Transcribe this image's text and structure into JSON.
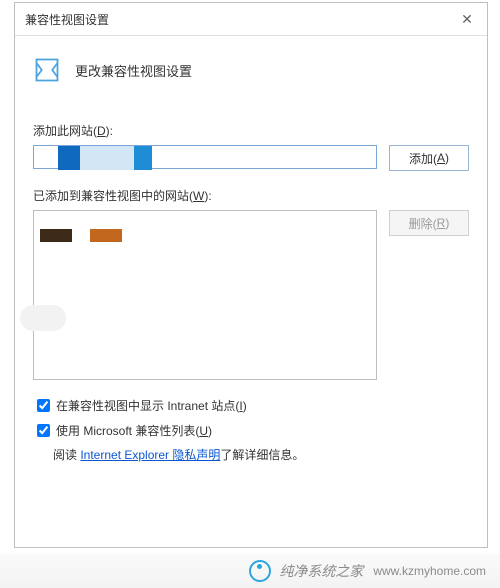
{
  "titlebar": {
    "title": "兼容性视图设置"
  },
  "header": {
    "text": "更改兼容性视图设置"
  },
  "add": {
    "label": "添加此网站(",
    "label_key": "D",
    "label_tail": "):",
    "btn": "添加(",
    "btn_key": "A",
    "btn_tail": ")"
  },
  "list": {
    "label": "已添加到兼容性视图中的网站(",
    "label_key": "W",
    "label_tail": "):",
    "remove_btn": "删除(",
    "remove_key": "R",
    "remove_tail": ")"
  },
  "checkbox1": {
    "label": "在兼容性视图中显示 Intranet 站点(",
    "key": "I",
    "tail": ")"
  },
  "checkbox2": {
    "label": "使用 Microsoft 兼容性列表(",
    "key": "U",
    "tail": ")"
  },
  "readline": {
    "prefix": "阅读 ",
    "link": "Internet Explorer 隐私声明",
    "suffix": "了解详细信息。"
  },
  "watermark": {
    "text": "纯净系统之家",
    "url": "www.kzmyhome.com"
  }
}
